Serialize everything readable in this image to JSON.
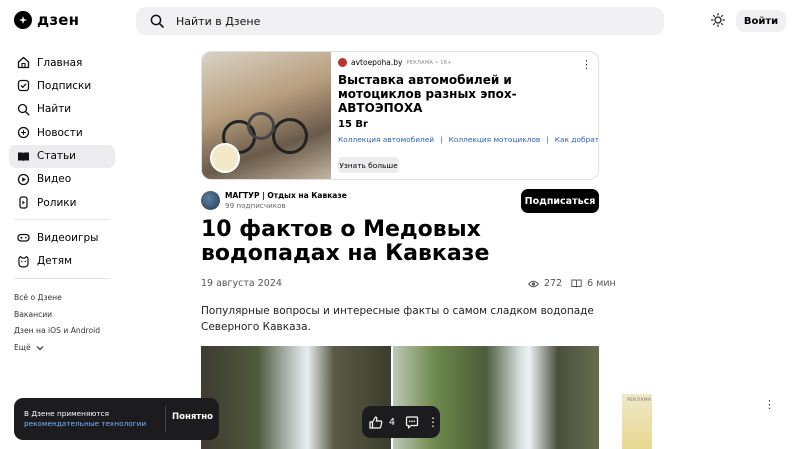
{
  "header": {
    "logo_text": "дзен",
    "search_placeholder": "Найти в Дзене",
    "login_label": "Войти"
  },
  "sidebar": {
    "items": [
      {
        "label": "Главная",
        "icon": "home-icon"
      },
      {
        "label": "Подписки",
        "icon": "subscriptions-icon"
      },
      {
        "label": "Найти",
        "icon": "search-icon"
      },
      {
        "label": "Новости",
        "icon": "news-icon"
      },
      {
        "label": "Статьи",
        "icon": "articles-icon",
        "active": true
      },
      {
        "label": "Видео",
        "icon": "video-icon"
      },
      {
        "label": "Ролики",
        "icon": "shorts-icon"
      }
    ],
    "secondary_items": [
      {
        "label": "Видеоигры",
        "icon": "gamepad-icon"
      },
      {
        "label": "Детям",
        "icon": "kids-icon"
      }
    ],
    "footer_links": [
      "Всё о Дзене",
      "Вакансии",
      "Дзен на iOS и Android",
      "Ещё"
    ]
  },
  "ad": {
    "source": "avtoepoha.by",
    "tag": "РЕКЛАМА • 16+",
    "title": "Выставка автомобилей и мотоциклов разных эпох-АВТОЭПОХА",
    "price": "15 Br",
    "links": [
      "Коллекция автомобилей",
      "Коллекция мотоциклов",
      "Как добраться"
    ],
    "more_label": "Узнать больше"
  },
  "channel": {
    "name": "МАГТУР | Отдых на Кавказе",
    "subscribers": "99 подписчиков",
    "subscribe_label": "Подписаться"
  },
  "article": {
    "title": "10 фактов о Медовых водопадах на Кавказе",
    "date": "19 августа 2024",
    "views": "272",
    "read_time": "6 мин",
    "lead": "Популярные вопросы и интересные факты о самом сладком водопаде Северного Кавказа."
  },
  "side_ad": {
    "tag": "РЕКЛАМА"
  },
  "cookie_banner": {
    "text": "В Дзене применяются",
    "link": "рекомендательные технологии",
    "button": "Понятно"
  },
  "action_bar": {
    "likes": "4"
  },
  "colors": {
    "accent_link": "#2a5fb0",
    "dark_panel": "#1c1c1e"
  }
}
